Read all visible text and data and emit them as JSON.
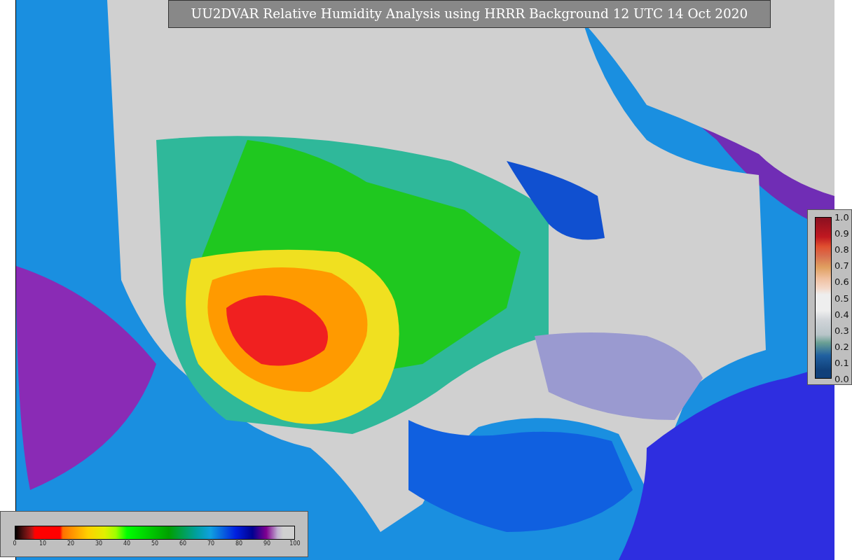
{
  "title": "UU2DVAR Relative Humidity Analysis using HRRR Background 12 UTC 14 Oct 2020",
  "humidity_colorbar": {
    "ticks": [
      "0",
      "10",
      "20",
      "30",
      "40",
      "50",
      "60",
      "70",
      "80",
      "90",
      "100"
    ]
  },
  "innovation_colorbar": {
    "ticks": [
      "1.0",
      "0.9",
      "0.8",
      "0.7",
      "0.6",
      "0.5",
      "0.4",
      "0.3",
      "0.2",
      "0.1",
      "0.0"
    ]
  }
}
